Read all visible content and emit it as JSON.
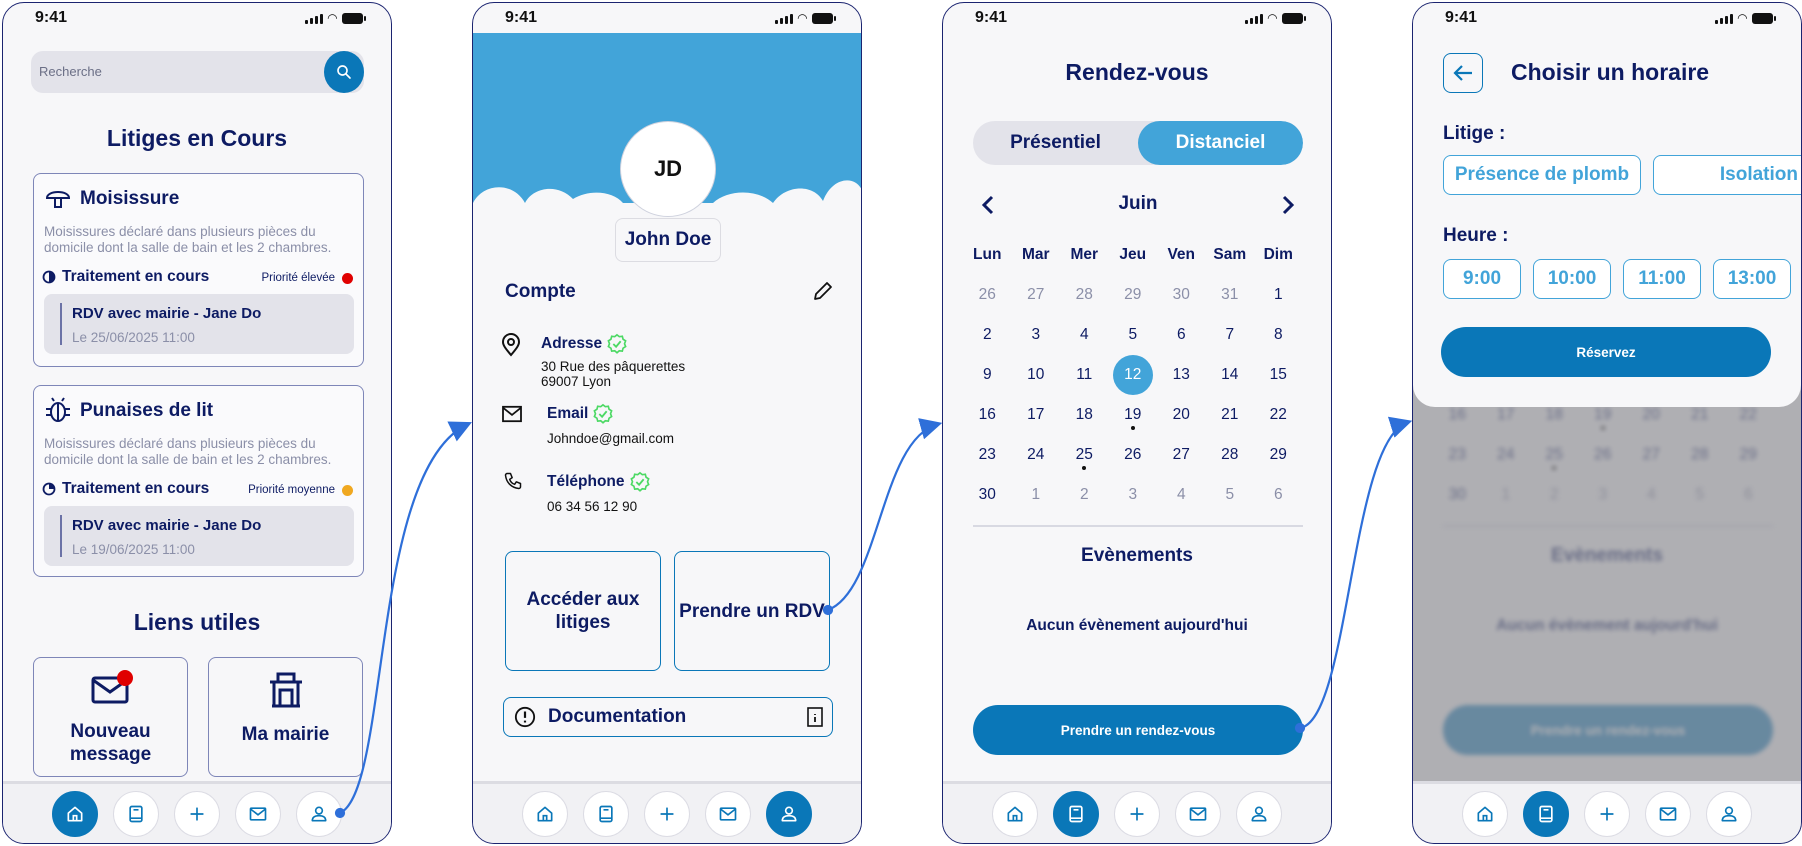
{
  "status_time": "9:41",
  "colors": {
    "primary": "#0a77b8",
    "accent": "#42a4d9",
    "navy": "#0d1b63",
    "priority_high": "#e00000",
    "priority_medium": "#f0a820",
    "verified": "#4cd964"
  },
  "screen1": {
    "search_placeholder": "Recherche",
    "title": "Litiges en Cours",
    "cases": [
      {
        "icon": "mushroom-icon",
        "title": "Moisissure",
        "description": "Moisissures déclaré dans plusieurs pièces du domicile dont la salle de bain et les 2 chambres.",
        "status": "Traitement en cours",
        "priority": "Priorité élevée",
        "rdv_title": "RDV avec mairie - Jane Do",
        "rdv_date": "Le 25/06/2025 11:00"
      },
      {
        "icon": "bug-icon",
        "title": "Punaises de lit",
        "description": "Moisissures déclaré dans plusieurs pièces du domicile dont la salle de bain et les 2 chambres.",
        "status": "Traitement en cours",
        "priority": "Priorité moyenne",
        "rdv_title": "RDV avec mairie - Jane Do",
        "rdv_date": "Le 19/06/2025 11:00"
      }
    ],
    "links_title": "Liens utiles",
    "links": [
      {
        "icon": "mail-icon",
        "label": "Nouveau message"
      },
      {
        "icon": "town-hall-icon",
        "label": "Ma mairie"
      }
    ]
  },
  "screen2": {
    "initials": "JD",
    "name": "John Doe",
    "account_title": "Compte",
    "address_label": "Adresse",
    "address_line1": "30 Rue des pâquerettes",
    "address_line2": "69007 Lyon",
    "email_label": "Email",
    "email_value": "Johndoe@gmail.com",
    "phone_label": "Téléphone",
    "phone_value": "06 34 56 12 90",
    "btn_litiges": "Accéder aux litiges",
    "btn_rdv": "Prendre un RDV",
    "doc_label": "Documentation"
  },
  "screen3": {
    "title": "Rendez-vous",
    "toggle": [
      "Présentiel",
      "Distanciel"
    ],
    "toggle_selected": "Distanciel",
    "month": "Juin",
    "weekdays": [
      "Lun",
      "Mar",
      "Mer",
      "Jeu",
      "Ven",
      "Sam",
      "Dim"
    ],
    "weeks": [
      [
        "26",
        "27",
        "28",
        "29",
        "30",
        "31",
        "1"
      ],
      [
        "2",
        "3",
        "4",
        "5",
        "6",
        "7",
        "8"
      ],
      [
        "9",
        "10",
        "11",
        "12",
        "13",
        "14",
        "15"
      ],
      [
        "16",
        "17",
        "18",
        "19",
        "20",
        "21",
        "22"
      ],
      [
        "23",
        "24",
        "25",
        "26",
        "27",
        "28",
        "29"
      ],
      [
        "30",
        "1",
        "2",
        "3",
        "4",
        "5",
        "6"
      ]
    ],
    "selected_day": "12",
    "event_days": [
      "19",
      "25"
    ],
    "events_title": "Evènements",
    "no_event": "Aucun évènement aujourd'hui",
    "cta": "Prendre un rendez-vous"
  },
  "screen4": {
    "title": "Choisir un horaire",
    "litige_label": "Litige :",
    "litiges": [
      "Présence de plomb",
      "Isolation"
    ],
    "heure_label": "Heure :",
    "hours": [
      "9:00",
      "10:00",
      "11:00",
      "13:00"
    ],
    "cta": "Réservez"
  },
  "nav_icons": [
    "home-icon",
    "book-icon",
    "plus-icon",
    "mail-icon",
    "user-icon"
  ]
}
